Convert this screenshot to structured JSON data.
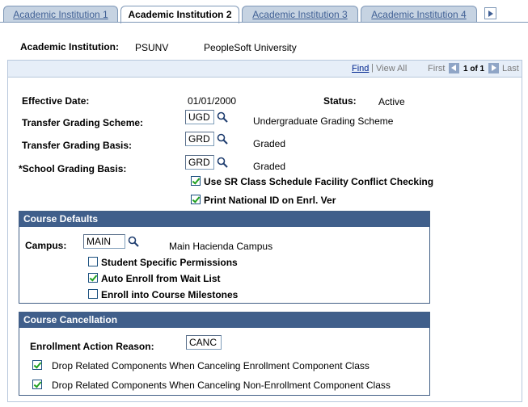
{
  "tabs": [
    {
      "label": "Academic Institution 1",
      "active": false
    },
    {
      "label": "Academic Institution 2",
      "active": true
    },
    {
      "label": "Academic Institution 3",
      "active": false
    },
    {
      "label": "Academic Institution 4",
      "active": false
    }
  ],
  "header": {
    "institution_label": "Academic Institution:",
    "institution_code": "PSUNV",
    "institution_name": "PeopleSoft University"
  },
  "scroll": {
    "find": "Find",
    "separator": "|",
    "view_all": "View All",
    "first": "First",
    "range": "1 of 1",
    "last": "Last"
  },
  "main": {
    "effective_date_label": "Effective Date:",
    "effective_date": "01/01/2000",
    "status_label": "Status:",
    "status": "Active",
    "transfer_scheme_label": "Transfer Grading Scheme:",
    "transfer_scheme_value": "UGD",
    "transfer_scheme_desc": "Undergraduate Grading Scheme",
    "transfer_basis_label": "Transfer Grading Basis:",
    "transfer_basis_value": "GRD",
    "transfer_basis_desc": "Graded",
    "school_basis_label": "*School Grading Basis:",
    "school_basis_value": "GRD",
    "school_basis_desc": "Graded",
    "facility_conflict_label": "Use SR Class Schedule Facility Conflict Checking",
    "facility_conflict_checked": true,
    "national_id_label": "Print National ID on Enrl. Ver",
    "national_id_checked": true
  },
  "course_defaults": {
    "title": "Course Defaults",
    "campus_label": "Campus:",
    "campus_value": "MAIN",
    "campus_desc": "Main Hacienda Campus",
    "student_perm_label": "Student Specific Permissions",
    "student_perm_checked": false,
    "auto_enroll_label": "Auto Enroll from Wait List",
    "auto_enroll_checked": true,
    "milestones_label": "Enroll into Course Milestones",
    "milestones_checked": false
  },
  "course_cancellation": {
    "title": "Course Cancellation",
    "reason_label": "Enrollment Action Reason:",
    "reason_value": "CANC",
    "drop_enrl_label": "Drop Related Components When Canceling Enrollment Component Class",
    "drop_enrl_checked": true,
    "drop_nonenrl_label": "Drop Related Components When Canceling Non-Enrollment Component Class",
    "drop_nonenrl_checked": true
  }
}
